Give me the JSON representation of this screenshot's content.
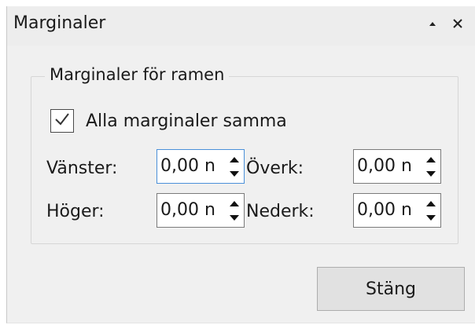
{
  "window": {
    "title": "Marginaler"
  },
  "group": {
    "title": "Marginaler för ramen",
    "checkbox_label": "Alla marginaler samma",
    "checkbox_checked": true
  },
  "fields": {
    "left_label": "Vänster:",
    "left_value": "0,00 n",
    "right_label": "Höger:",
    "right_value": "0,00 n",
    "top_label": "Överk:",
    "top_value": "0,00 n",
    "bottom_label": "Nederk:",
    "bottom_value": "0,00 n"
  },
  "buttons": {
    "close_label": "Stäng"
  },
  "icons": {
    "float": "float-icon",
    "close": "close-icon",
    "checkmark": "checkmark-icon",
    "spin_up": "arrow-up-icon",
    "spin_down": "arrow-down-icon"
  },
  "colors": {
    "window_bg": "#f0f0f0",
    "focus_border": "#4a90d9",
    "button_bg": "#e1e1e1"
  }
}
